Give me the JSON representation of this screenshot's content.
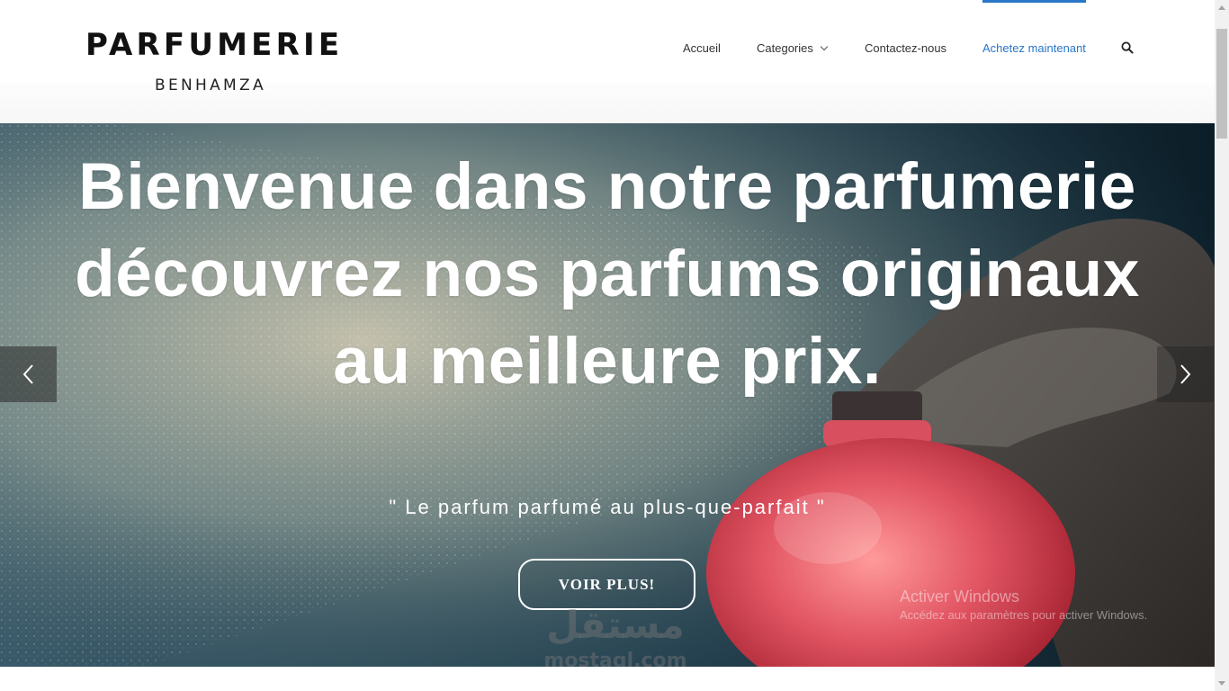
{
  "brand": {
    "name": "PARFUMERIE",
    "subtitle": "BENHAMZA"
  },
  "nav": {
    "items": [
      {
        "label": "Accueil"
      },
      {
        "label": "Categories"
      },
      {
        "label": "Contactez-nous"
      },
      {
        "label": "Achetez maintenant"
      }
    ],
    "search_icon": "search-icon"
  },
  "hero": {
    "headline": "Bienvenue dans notre parfumerie découvrez nos parfums originaux au meilleure prix.",
    "tagline": "\" Le parfum parfumé au plus-que-parfait \"",
    "cta_label": "VOIR PLUS!",
    "prev_icon": "chevron-left-icon",
    "next_icon": "chevron-right-icon"
  },
  "watermarks": {
    "windows_title": "Activer Windows",
    "windows_sub": "Accédez aux paramètres pour activer Windows.",
    "mostaql_arabic": "مستقل",
    "mostaql_latin": "mostaql.com"
  },
  "colors": {
    "accent": "#2a76c8",
    "text": "#333333",
    "hero_bg": "#1d3a4b",
    "bottle": "#e05060"
  }
}
